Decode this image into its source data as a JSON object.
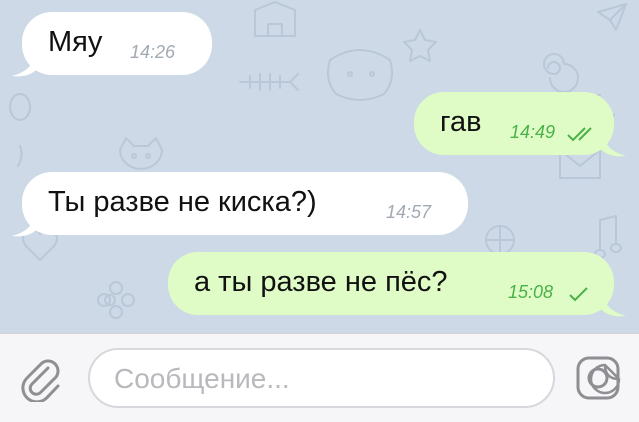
{
  "messages": [
    {
      "direction": "incoming",
      "text": "Мяу",
      "time": "14:26",
      "status": "none"
    },
    {
      "direction": "outgoing",
      "text": "гав",
      "time": "14:49",
      "status": "read"
    },
    {
      "direction": "incoming",
      "text": "Ты разве не киска?)",
      "time": "14:57",
      "status": "none"
    },
    {
      "direction": "outgoing",
      "text": "а ты разве не пёс?",
      "time": "15:08",
      "status": "delivered"
    }
  ],
  "input": {
    "placeholder": "Сообщение..."
  },
  "icons": {
    "attach": "paperclip-icon",
    "sticker": "sticker-icon",
    "camera": "camera-icon",
    "read": "double-check-icon",
    "delivered": "check-icon"
  },
  "colors": {
    "chat_background": "#cdd9e6",
    "incoming_bubble": "#ffffff",
    "outgoing_bubble": "#e0fcc6",
    "outgoing_time": "#4bb148",
    "incoming_time": "#a1a9b2",
    "icon_gray": "#8e8e93"
  }
}
